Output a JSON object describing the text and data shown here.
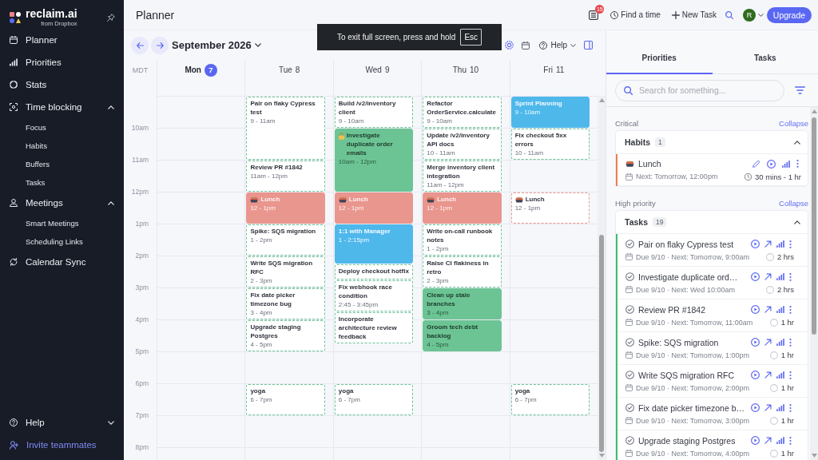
{
  "sidebar": {
    "logo": {
      "name": "reclaim.ai",
      "tagline": "from Dropbox"
    },
    "items": [
      {
        "label": "Planner"
      },
      {
        "label": "Priorities"
      },
      {
        "label": "Stats"
      },
      {
        "label": "Time blocking",
        "expanded": true,
        "children": [
          {
            "label": "Focus"
          },
          {
            "label": "Habits"
          },
          {
            "label": "Buffers"
          },
          {
            "label": "Tasks"
          }
        ]
      },
      {
        "label": "Meetings",
        "expanded": true,
        "children": [
          {
            "label": "Smart Meetings"
          },
          {
            "label": "Scheduling Links"
          }
        ]
      },
      {
        "label": "Calendar Sync"
      }
    ],
    "footer": [
      {
        "kind": "menu",
        "label": "Help",
        "expanded": false
      },
      {
        "kind": "invite",
        "label": "Invite teammates"
      }
    ]
  },
  "header": {
    "title": "Planner",
    "badge": "15",
    "actions": [
      "Find a time",
      "New Task"
    ],
    "avatar": "R",
    "upgrade": "Upgrade"
  },
  "fullscreen_notice": {
    "text": "To exit full screen, press and hold",
    "key": "Esc"
  },
  "calendar": {
    "month": "September 2026",
    "help": "Help",
    "timezone": "MDT",
    "hours": [
      "10am",
      "11am",
      "12pm",
      "1pm",
      "2pm",
      "3pm",
      "4pm",
      "5pm",
      "6pm",
      "7pm",
      "8pm"
    ],
    "days": [
      {
        "day": "Mon",
        "date": "7",
        "today": true
      },
      {
        "day": "Tue",
        "date": "8",
        "today": false,
        "events": [
          {
            "title": "Pair on flaky Cypress test",
            "time": "9 - 11am",
            "kind": "task",
            "filled": false,
            "locked": false,
            "color": "#6cc495"
          },
          {
            "title": "Review PR #1842",
            "time": "11am - 12pm",
            "kind": "task",
            "filled": false,
            "locked": false,
            "color": "#6cc495"
          },
          {
            "title": "Lunch",
            "time": "12 - 1pm",
            "kind": "habit",
            "filled": true,
            "locked": false,
            "color": "#e9968e"
          },
          {
            "title": "Spike: SQS migration",
            "time": "1 - 2pm",
            "kind": "task",
            "filled": false,
            "locked": false,
            "color": "#6cc495"
          },
          {
            "title": "Write SQS migration RFC",
            "time": "2 - 3pm",
            "kind": "task",
            "filled": false,
            "locked": false,
            "color": "#6cc495"
          },
          {
            "title": "Fix date picker timezone bug",
            "time": "3 - 4pm",
            "kind": "task",
            "filled": false,
            "locked": false,
            "color": "#6cc495"
          },
          {
            "title": "Upgrade staging Postgres",
            "time": "4 - 5pm",
            "kind": "task",
            "filled": false,
            "locked": false,
            "color": "#6cc495"
          },
          {
            "title": "yoga",
            "time": "6 - 7pm",
            "kind": "task",
            "filled": false,
            "locked": false,
            "color": "#6cc495"
          }
        ]
      },
      {
        "day": "Wed",
        "date": "9",
        "today": false,
        "events": [
          {
            "title": "Build /v2/inventory client",
            "time": "9 - 10am",
            "kind": "task",
            "filled": false,
            "locked": false,
            "color": "#6cc495"
          },
          {
            "title": "Investigate duplicate order emails",
            "time": "10am - 12pm",
            "kind": "task",
            "filled": true,
            "locked": true,
            "color": "#6cc495"
          },
          {
            "title": "Lunch",
            "time": "12 - 1pm",
            "kind": "habit",
            "filled": true,
            "locked": false,
            "color": "#e9968e"
          },
          {
            "title": "1:1 with Manager",
            "time": "1 - 2:15pm",
            "kind": "meeting",
            "filled": true,
            "locked": false,
            "color": "#4fb8eb"
          },
          {
            "title": "Deploy checkout hotfix",
            "kind": "task",
            "filled": false,
            "locked": false,
            "color": "#6cc495"
          },
          {
            "title": "Fix webhook race condition",
            "time": "2:45 - 3:45pm",
            "kind": "task",
            "filled": false,
            "locked": false,
            "color": "#6cc495"
          },
          {
            "title": "Incorporate architecture review feedback",
            "kind": "task",
            "filled": false,
            "locked": false,
            "color": "#6cc495"
          },
          {
            "title": "yoga",
            "time": "6 - 7pm",
            "kind": "task",
            "filled": false,
            "locked": false,
            "color": "#6cc495"
          }
        ]
      },
      {
        "day": "Thu",
        "date": "10",
        "today": false,
        "events": [
          {
            "title": "Refactor OrderService.calculate",
            "time": "9 - 10am",
            "kind": "task",
            "filled": false,
            "locked": false,
            "color": "#6cc495"
          },
          {
            "title": "Update /v2/inventory API docs",
            "time": "10 - 11am",
            "kind": "task",
            "filled": false,
            "locked": false,
            "color": "#6cc495"
          },
          {
            "title": "Merge inventory client integration",
            "time": "11am - 12pm",
            "kind": "task",
            "filled": false,
            "locked": false,
            "color": "#6cc495"
          },
          {
            "title": "Lunch",
            "time": "12 - 1pm",
            "kind": "habit",
            "filled": true,
            "locked": false,
            "color": "#e9968e"
          },
          {
            "title": "Write on-call runbook notes",
            "time": "1 - 2pm",
            "kind": "task",
            "filled": false,
            "locked": false,
            "color": "#6cc495"
          },
          {
            "title": "Raise CI flakiness in retro",
            "time": "2 - 3pm",
            "kind": "task",
            "filled": false,
            "locked": false,
            "color": "#6cc495"
          },
          {
            "title": "Clean up stale branches",
            "time": "3 - 4pm",
            "kind": "task",
            "filled": true,
            "locked": false,
            "color": "#6cc495"
          },
          {
            "title": "Groom tech debt backlog",
            "time": "4 - 5pm",
            "kind": "task",
            "filled": true,
            "locked": false,
            "color": "#6cc495"
          }
        ]
      },
      {
        "day": "Fri",
        "date": "11",
        "today": false,
        "events": [
          {
            "title": "Sprint Planning",
            "time": "9 - 10am",
            "kind": "meeting",
            "filled": true,
            "locked": false,
            "color": "#4fb8eb"
          },
          {
            "title": "Fix checkout 5xx errors",
            "time": "10 - 11am",
            "kind": "task",
            "filled": false,
            "locked": false,
            "color": "#6cc495"
          },
          {
            "title": "Lunch",
            "time": "12 - 1pm",
            "kind": "habit",
            "filled": false,
            "locked": false,
            "color": "#e9968e"
          },
          {
            "title": "yoga",
            "time": "6 - 7pm",
            "kind": "task",
            "filled": false,
            "locked": false,
            "color": "#6cc495"
          }
        ]
      }
    ]
  },
  "panel": {
    "tabs": [
      {
        "label": "Priorities",
        "selected": true
      },
      {
        "label": "Tasks",
        "selected": false
      }
    ],
    "search": {
      "placeholder": "Search for something..."
    },
    "groups": [
      {
        "label": "Critical",
        "action": "Collapse",
        "color": "#ee7c54",
        "section": {
          "title": "Habits",
          "count": "1",
          "expanded": true,
          "items": [
            {
              "kind": "habit",
              "title": "Lunch",
              "detail": "Next: Tomorrow, 12:00pm",
              "duration": "30 mins - 1 hr"
            }
          ]
        }
      },
      {
        "label": "High priority",
        "action": "Collapse",
        "color": "#3dbd72",
        "section": {
          "title": "Tasks",
          "count": "19",
          "expanded": true,
          "items": [
            {
              "kind": "task",
              "title": "Pair on flaky Cypress test",
              "detail": "Due 9/10 · Next: Tomorrow, 9:00am",
              "duration": "2 hrs"
            },
            {
              "kind": "task",
              "title": "Investigate duplicate ord…",
              "detail": "Due 9/10 · Next: Wed 10:00am",
              "duration": "2 hrs"
            },
            {
              "kind": "task",
              "title": "Review PR #1842",
              "detail": "Due 9/10 · Next: Tomorrow, 11:00am",
              "duration": "1 hr"
            },
            {
              "kind": "task",
              "title": "Spike: SQS migration",
              "detail": "Due 9/10 · Next: Tomorrow, 1:00pm",
              "duration": "1 hr"
            },
            {
              "kind": "task",
              "title": "Write SQS migration RFC",
              "detail": "Due 9/10 · Next: Tomorrow, 2:00pm",
              "duration": "1 hr"
            },
            {
              "kind": "task",
              "title": "Fix date picker timezone b…",
              "detail": "Due 9/10 · Next: Tomorrow, 3:00pm",
              "duration": "1 hr"
            },
            {
              "kind": "task",
              "title": "Upgrade staging Postgres",
              "detail": "Due 9/10 · Next: Tomorrow, 4:00pm",
              "duration": "1 hr"
            }
          ]
        }
      }
    ]
  }
}
